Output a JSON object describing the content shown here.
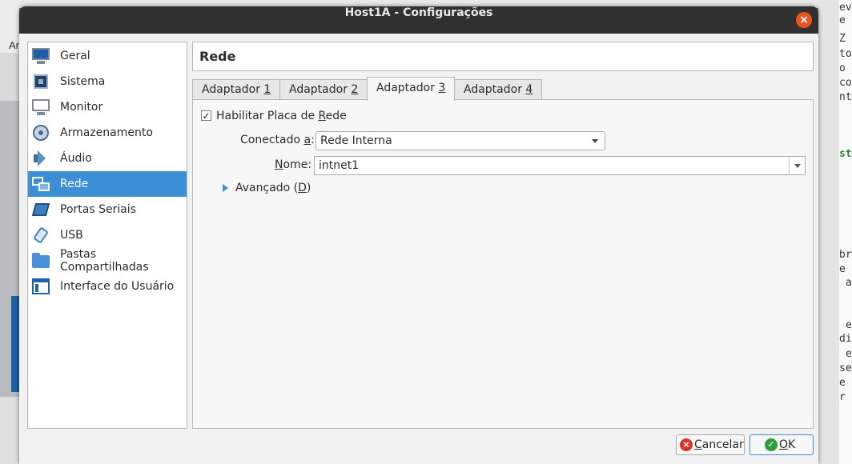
{
  "window": {
    "title": "Host1A - Configurações"
  },
  "background": {
    "left_label": "Ar",
    "right_lines": [
      "ev",
      "e",
      "Z",
      "to",
      "o",
      "co",
      "nt",
      "st",
      "br",
      "e",
      "a",
      "e",
      "di",
      "e",
      "se",
      "e",
      "r"
    ]
  },
  "sidebar": {
    "items": [
      {
        "label": "Geral",
        "icon": "monitor-icon"
      },
      {
        "label": "Sistema",
        "icon": "chip-icon"
      },
      {
        "label": "Monitor",
        "icon": "display-icon"
      },
      {
        "label": "Armazenamento",
        "icon": "disk-icon"
      },
      {
        "label": "Áudio",
        "icon": "speaker-icon"
      },
      {
        "label": "Rede",
        "icon": "network-icon",
        "selected": true
      },
      {
        "label": "Portas Seriais",
        "icon": "serial-port-icon"
      },
      {
        "label": "USB",
        "icon": "usb-icon"
      },
      {
        "label": "Pastas Compartilhadas",
        "icon": "folder-icon"
      },
      {
        "label": "Interface do Usuário",
        "icon": "user-interface-icon"
      }
    ]
  },
  "section": {
    "title": "Rede"
  },
  "tabs": [
    {
      "pre": "Adaptador ",
      "key": "1"
    },
    {
      "pre": "Adaptador ",
      "key": "2"
    },
    {
      "pre": "Adaptador ",
      "key": "3",
      "active": true
    },
    {
      "pre": "Adaptador ",
      "key": "4"
    }
  ],
  "form": {
    "enable": {
      "pre": "Habilitar Placa de ",
      "key": "R",
      "post": "ede",
      "checked": true
    },
    "attached": {
      "pre": "Conectado ",
      "key": "a",
      "post": ":",
      "value": "Rede Interna"
    },
    "name": {
      "key": "N",
      "post": "ome:",
      "value": "intnet1"
    },
    "advanced": {
      "pre": "Avançado (",
      "key": "D",
      "post": ")"
    }
  },
  "buttons": {
    "cancel": {
      "key": "C",
      "post": "ancelar"
    },
    "ok": {
      "key": "O",
      "post": "K"
    }
  },
  "colors": {
    "accent": "#3a8fd6",
    "titlebar": "#303030",
    "close": "#e95420"
  }
}
